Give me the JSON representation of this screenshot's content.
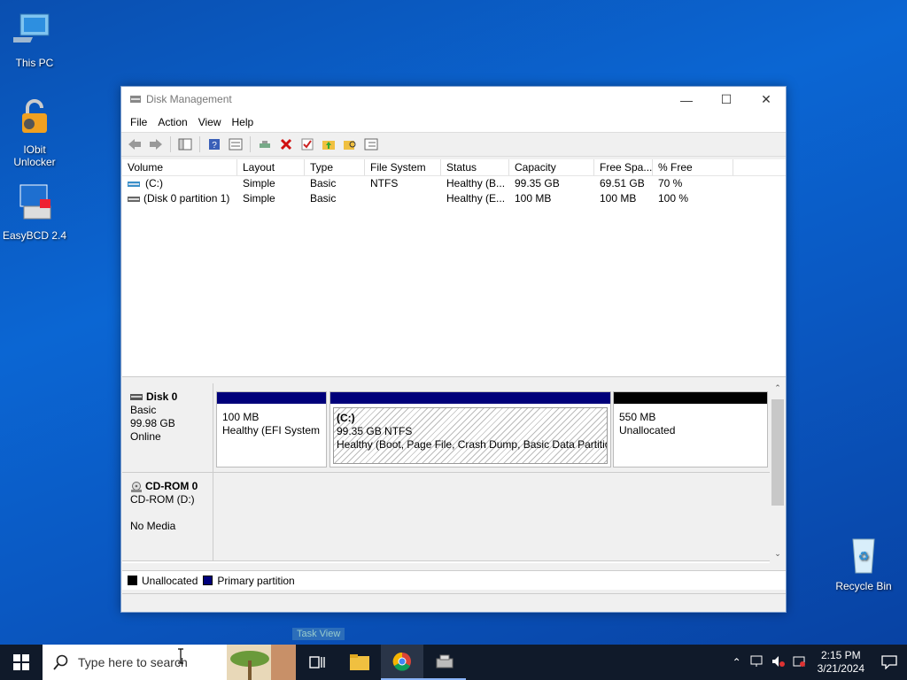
{
  "desktop": {
    "icons": [
      {
        "label": "This PC"
      },
      {
        "label": "IObit Unlocker"
      },
      {
        "label": "EasyBCD 2.4"
      },
      {
        "label": "Recycle Bin"
      }
    ]
  },
  "window": {
    "title": "Disk Management",
    "controls": {
      "minimize": "—",
      "maximize": "☐",
      "close": "✕"
    },
    "menu": [
      "File",
      "Action",
      "View",
      "Help"
    ],
    "list": {
      "columns": [
        "Volume",
        "Layout",
        "Type",
        "File System",
        "Status",
        "Capacity",
        "Free Spa...",
        "% Free"
      ],
      "rows": [
        [
          "(C:)",
          "Simple",
          "Basic",
          "NTFS",
          "Healthy (B...",
          "99.35 GB",
          "69.51 GB",
          "70 %"
        ],
        [
          "(Disk 0 partition 1)",
          "Simple",
          "Basic",
          "",
          "Healthy (E...",
          "100 MB",
          "100 MB",
          "100 %"
        ]
      ]
    },
    "disks": [
      {
        "name": "Disk 0",
        "type": "Basic",
        "size": "99.98 GB",
        "state": "Online",
        "partitions": [
          {
            "line1": "100 MB",
            "line2": "Healthy (EFI System P",
            "bar": "#00007a"
          },
          {
            "title": "(C:)",
            "line1": "99.35 GB NTFS",
            "line2": "Healthy (Boot, Page File, Crash Dump, Basic Data Partitior",
            "bar": "#00007a"
          },
          {
            "line1": "550 MB",
            "line2": "Unallocated",
            "bar": "#000000"
          }
        ]
      },
      {
        "name": "CD-ROM 0",
        "type": "CD-ROM (D:)",
        "media": "No Media"
      }
    ],
    "legend": [
      {
        "label": "Unallocated",
        "color": "#000000"
      },
      {
        "label": "Primary partition",
        "color": "#00007a"
      }
    ]
  },
  "taskbar": {
    "search_placeholder": "Type here to search",
    "tooltip": "Task View",
    "clock_time": "2:15 PM",
    "clock_date": "3/21/2024"
  }
}
